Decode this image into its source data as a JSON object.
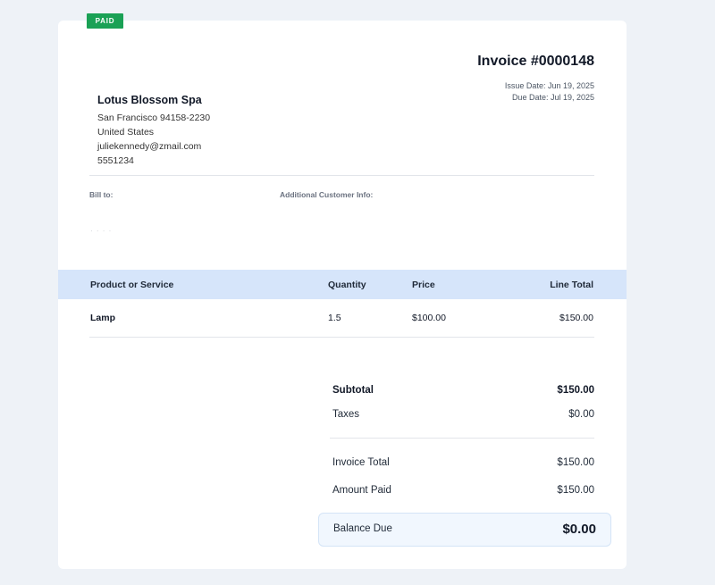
{
  "status_badge": "PAID",
  "invoice": {
    "title": "Invoice #0000148",
    "issue_date": "Issue Date: Jun 19, 2025",
    "due_date": "Due Date: Jul 19, 2025"
  },
  "business": {
    "name": "Lotus Blossom Spa",
    "address_line": "San Francisco 94158-2230",
    "country": "United States",
    "email": "juliekennedy@zmail.com",
    "phone": "5551234"
  },
  "bill_to_label": "Bill to:",
  "bill_to_value": "· · · ·",
  "additional_info_label": "Additional Customer Info:",
  "table": {
    "headers": {
      "product": "Product or Service",
      "quantity": "Quantity",
      "price": "Price",
      "line_total": "Line Total"
    },
    "rows": [
      {
        "product": "Lamp",
        "quantity": "1.5",
        "price": "$100.00",
        "line_total": "$150.00"
      }
    ]
  },
  "summary": {
    "subtotal_label": "Subtotal",
    "subtotal_value": "$150.00",
    "taxes_label": "Taxes",
    "taxes_value": "$0.00",
    "invoice_total_label": "Invoice Total",
    "invoice_total_value": "$150.00",
    "amount_paid_label": "Amount Paid",
    "amount_paid_value": "$150.00",
    "balance_due_label": "Balance Due",
    "balance_due_value": "$0.00"
  },
  "colors": {
    "badge": "#1aa155",
    "table_header": "#d6e5fa",
    "balance_box": "#f1f7fe",
    "background": "#eef2f7"
  }
}
